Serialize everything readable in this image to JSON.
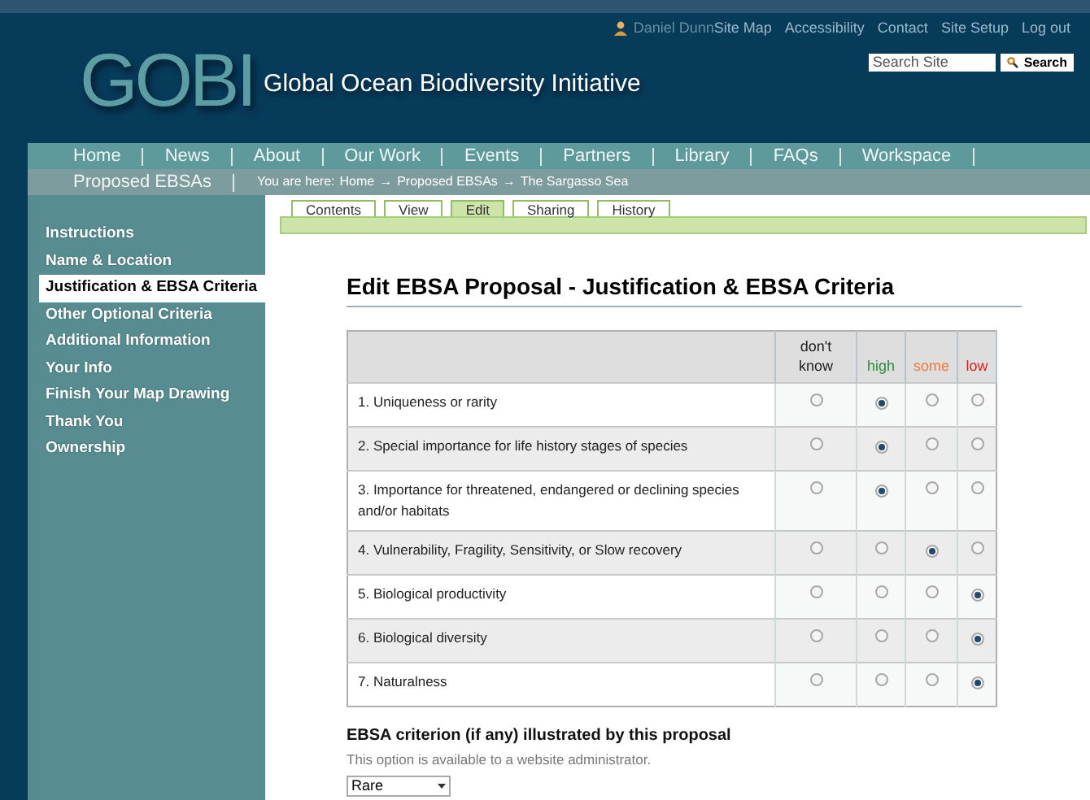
{
  "user": {
    "name": "Daniel Dunn"
  },
  "top_links": [
    "Site Map",
    "Accessibility",
    "Contact",
    "Site Setup",
    "Log out"
  ],
  "search": {
    "placeholder": "Search Site",
    "button": "Search"
  },
  "logo": {
    "mark": "GOBI",
    "title": "Global Ocean Biodiversity Initiative"
  },
  "nav": [
    "Home",
    "News",
    "About",
    "Our Work",
    "Events",
    "Partners",
    "Library",
    "FAQs",
    "Workspace",
    "Proposed EBSAs"
  ],
  "breadcrumb": {
    "label": "You are here:",
    "items": [
      "Home",
      "Proposed EBSAs",
      "The Sargasso Sea"
    ],
    "separator": "→"
  },
  "sidebar": {
    "items": [
      {
        "label": "Instructions",
        "selected": false
      },
      {
        "label": "Name & Location",
        "selected": false
      },
      {
        "label": "Justification & EBSA Criteria",
        "selected": true
      },
      {
        "label": "Other Optional Criteria",
        "selected": false
      },
      {
        "label": "Additional Information",
        "selected": false
      },
      {
        "label": "Your Info",
        "selected": false
      },
      {
        "label": "Finish Your Map Drawing",
        "selected": false
      },
      {
        "label": "Thank You",
        "selected": false
      },
      {
        "label": "Ownership",
        "selected": false
      }
    ]
  },
  "tabs": [
    {
      "label": "Contents",
      "selected": false
    },
    {
      "label": "View",
      "selected": false
    },
    {
      "label": "Edit",
      "selected": true
    },
    {
      "label": "Sharing",
      "selected": false
    },
    {
      "label": "History",
      "selected": false
    }
  ],
  "heading": "Edit EBSA Proposal - Justification & EBSA Criteria",
  "table": {
    "columns": [
      {
        "label": "don't know",
        "color": "#222222"
      },
      {
        "label": "high",
        "color": "#2e8b3a"
      },
      {
        "label": "some",
        "color": "#ee7a3a"
      },
      {
        "label": "low",
        "color": "#e02020"
      }
    ],
    "rows": [
      {
        "label": "1. Uniqueness or rarity",
        "choices": [
          {
            "selected": false
          },
          {
            "selected": true
          },
          {
            "selected": false
          },
          {
            "selected": false
          }
        ]
      },
      {
        "label": "2. Special importance for life history stages of species",
        "choices": [
          {
            "selected": false
          },
          {
            "selected": true
          },
          {
            "selected": false
          },
          {
            "selected": false
          }
        ]
      },
      {
        "label": "3. Importance for threatened, endangered or declining species and/or habitats",
        "choices": [
          {
            "selected": false
          },
          {
            "selected": true
          },
          {
            "selected": false
          },
          {
            "selected": false
          }
        ]
      },
      {
        "label": "4. Vulnerability, Fragility, Sensitivity, or Slow recovery",
        "choices": [
          {
            "selected": false
          },
          {
            "selected": false
          },
          {
            "selected": true
          },
          {
            "selected": false
          }
        ]
      },
      {
        "label": "5. Biological productivity",
        "choices": [
          {
            "selected": false
          },
          {
            "selected": false
          },
          {
            "selected": false
          },
          {
            "selected": true
          }
        ]
      },
      {
        "label": "6. Biological diversity",
        "choices": [
          {
            "selected": false
          },
          {
            "selected": false
          },
          {
            "selected": false
          },
          {
            "selected": true
          }
        ]
      },
      {
        "label": "7. Naturalness",
        "choices": [
          {
            "selected": false
          },
          {
            "selected": false
          },
          {
            "selected": false
          },
          {
            "selected": true
          }
        ]
      }
    ]
  },
  "criterion": {
    "label": "EBSA criterion (if any) illustrated by this proposal",
    "help": "This option is available to a website administrator.",
    "value": "Rare"
  }
}
